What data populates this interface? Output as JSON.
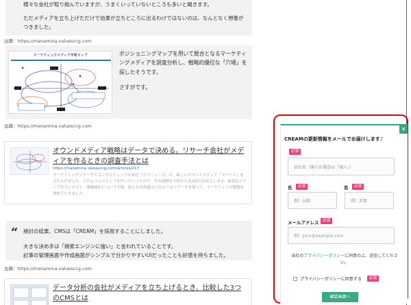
{
  "article": {
    "quote1_line1": "様々な会社が取り組んでいますが、うまくいっていないところも多いと聞きます。",
    "quote1_line2": "ただメディアを立ち上げただけで効果が立ちどころに出るわけではないのは、なんとなく想像がつきました。",
    "source1": "出典：https://manamina.valuesccg.com",
    "figure_title": "マーケティングメディア市場マップ",
    "figure_text1": "ポジショニングマップを用いて競合となるマーケティングメディアを調査分析し、戦略的優位な「穴場」を探したそうです。",
    "figure_text2": "さすがです。",
    "source2": "出典：https://manamina.valuesccg.com",
    "card1": {
      "title": "オウンドメディア戦略はデータで決める。リサーチ会社がメディアを作るときの調査手法とは",
      "url": "https://manamina.valuesccg.com/articles/217",
      "desc": "マーケティングリサーチとコンサルティングの会社「ヴァリューズ」が、新しいオウンドメディア「マナミナ」を立ち上げました。どのようにメディアを作っていったのか、その過程を今回から全4回でお伝えします。前回はメディアのコンセプト・戦略設計についての話、私たちの両者はどのようなリサーチを使って、マーケティング戦略を決めていきました。"
    },
    "quote_mark": "“",
    "quote2_line1": "検討の結果、CMSは「CREAM」を採用することにしました。",
    "quote2_line2": "大きな決め手は「検索エンジンに強い」と言われていることです。",
    "quote2_line3": "記事の管理画面や作成画面がシンプルで分かりやすいUIだったことも好感を持ちました。",
    "source3": "出典：https://manamina.valuesccg.com",
    "card2": {
      "title": "データ分析の会社がメディアを立ち上げるとき、比較した3つのCMSとは"
    }
  },
  "popup": {
    "close": "×",
    "heading": "CREAMの更新情報をメールでお届けします♪",
    "required": "必須",
    "company_placeholder": "会社名（個人の場合は「個人」）",
    "last_name_label": "氏",
    "last_name_placeholder": "例）山田",
    "first_name_label": "名",
    "first_name_placeholder": "例）太郎",
    "email_label": "メールアドレス",
    "email_placeholder": "例）your@example.com",
    "notice_pre": "当社の",
    "notice_link": "プライバシーポリシー",
    "notice_post": "に同意の上、送信してください。",
    "agree_label": "プライバシーポリシーに同意する",
    "submit": "確認画面へ"
  },
  "colors": {
    "accent": "#37a481",
    "required": "#e8437b",
    "highlight": "#e00000"
  }
}
